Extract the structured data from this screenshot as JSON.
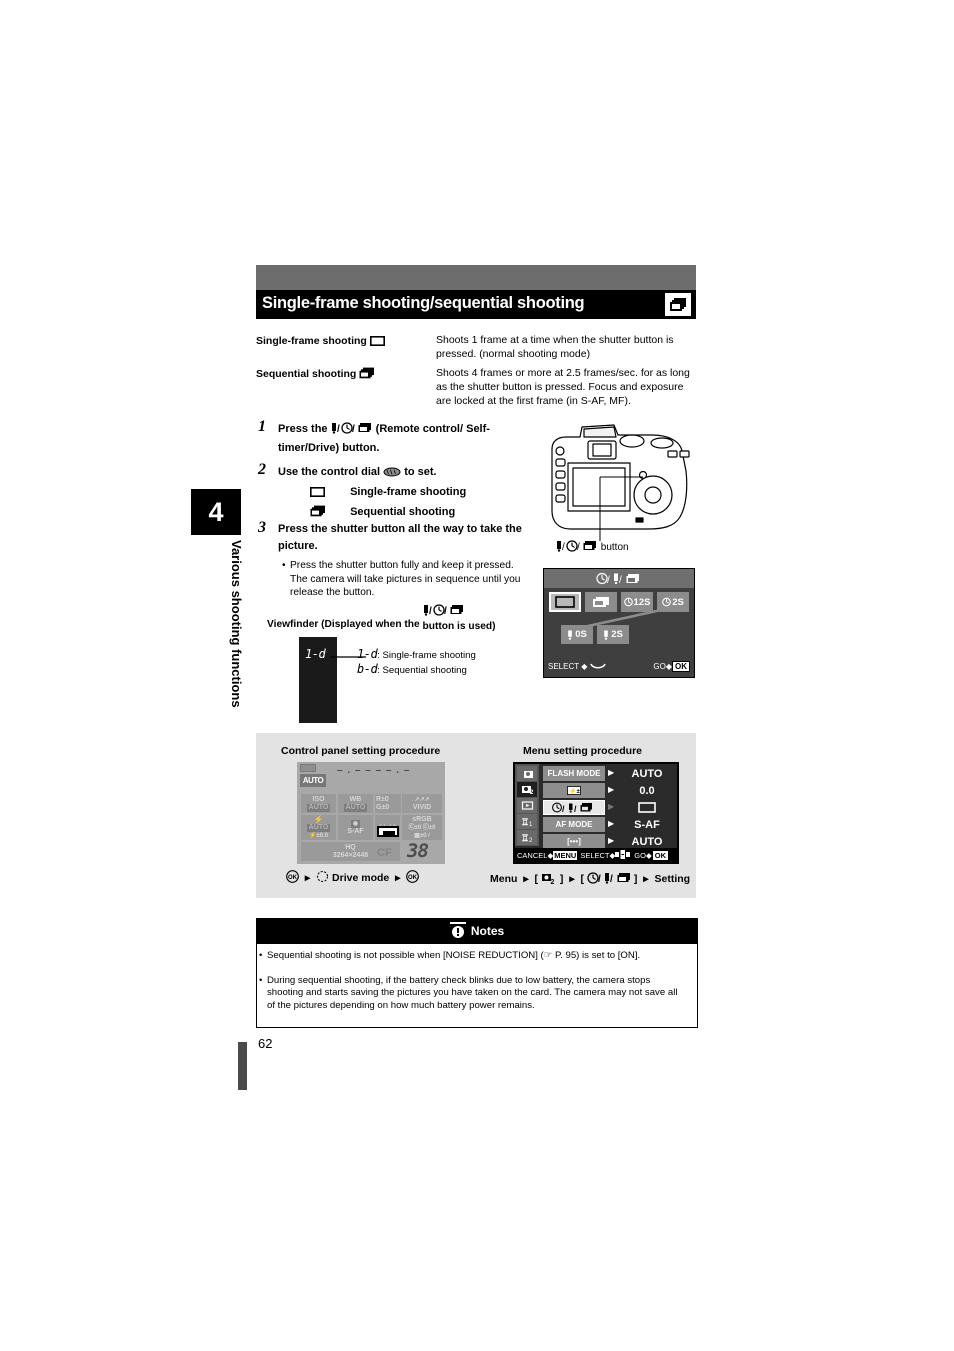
{
  "sidebar": {
    "chapter_number": "4",
    "chapter_title": "Various shooting functions"
  },
  "header": {
    "title": "Single-frame shooting/sequential shooting",
    "badge_icon": "sequential-shooting-icon"
  },
  "definitions": [
    {
      "term": "Single-frame shooting",
      "term_icon": "single-frame-icon",
      "body": "Shoots 1 frame at a time when the shutter button is pressed. (normal shooting mode)"
    },
    {
      "term": "Sequential shooting",
      "term_icon": "sequential-shooting-icon",
      "body": "Shoots 4 frames or more at 2.5 frames/sec. for as long as the shutter button is pressed. Focus and exposure are locked at the first frame (in S-AF, MF)."
    }
  ],
  "steps": [
    {
      "number": "1",
      "text_before": "Press the",
      "icon": "remote-selftimer-drive-icon",
      "text_after": "(Remote control/ Self-timer/Drive) button."
    },
    {
      "number": "2",
      "text_before": "Use the control dial",
      "icon": "control-dial-icon",
      "text_after": "to set.",
      "options": [
        {
          "icon": "single-frame-icon",
          "label": "Single-frame shooting"
        },
        {
          "icon": "sequential-shooting-icon",
          "label": "Sequential shooting"
        }
      ]
    },
    {
      "number": "3",
      "text_before": "Press the shutter button all the way to take the picture.",
      "bullet": "Press the shutter button fully and keep it pressed. The camera will take pictures in sequence until you release the button."
    }
  ],
  "viewfinder": {
    "caption": "Viewfinder (Displayed when the",
    "caption_icon": "remote-selftimer-drive-icon",
    "caption_end": "button is used)",
    "display_value": "1-d",
    "legend": [
      {
        "code": "1-d",
        "label": ": Single-frame shooting"
      },
      {
        "code": "b-d",
        "label": ": Sequential shooting"
      }
    ]
  },
  "camera_figure": {
    "caption_icon": "remote-selftimer-drive-icon",
    "caption": "button"
  },
  "drive_lcd": {
    "title": "◴/☉/❐",
    "title_text": "Self-timer / Remote / Drive",
    "row1": [
      {
        "label": "",
        "icon": "single-frame-icon",
        "selected": true
      },
      {
        "label": "",
        "icon": "sequential-shooting-icon",
        "selected": false
      },
      {
        "label": "12S",
        "icon": "self-timer-icon",
        "selected": false
      },
      {
        "label": "2S",
        "icon": "self-timer-icon",
        "selected": false
      }
    ],
    "row2": [
      {
        "label": "0S",
        "icon": "remote-icon",
        "selected": false
      },
      {
        "label": "2S",
        "icon": "remote-icon",
        "selected": false
      }
    ],
    "footer_left": "SELECT",
    "footer_right": "GO",
    "footer_ok": "OK"
  },
  "procedures": {
    "control_panel": {
      "heading": "Control panel setting procedure",
      "caption": "Drive mode",
      "panel": {
        "top_dashes": "– . – – –   – . –",
        "mode": "AUTO",
        "cells": [
          {
            "label": "ISO",
            "value": "AUTO"
          },
          {
            "label": "WB",
            "value": "AUTO"
          },
          {
            "label": "R±0",
            "value": "G±0"
          },
          {
            "label": "",
            "value": "VIVID"
          },
          {
            "label": "flash",
            "value": "AUTO"
          },
          {
            "label": "",
            "value": "S-AF"
          },
          {
            "label": "",
            "value": ""
          },
          {
            "label": "",
            "value": "sRGB"
          },
          {
            "label": "",
            "value": "±0.0"
          },
          {
            "label": "",
            "value": "±0"
          }
        ],
        "quality": "HQ",
        "resolution": "3264×2448",
        "card": "CF",
        "frames_remaining": "38"
      }
    },
    "menu": {
      "heading": "Menu setting procedure",
      "caption_parts": [
        "Menu",
        "[",
        "]",
        "[",
        "]",
        "Setting"
      ],
      "caption_tab": "2",
      "rows": [
        {
          "label": "FLASH MODE",
          "value": "AUTO",
          "highlight": false
        },
        {
          "label": "±",
          "value": "0.0",
          "highlight": false
        },
        {
          "label": "drive",
          "value": "single-frame-icon",
          "highlight": true
        },
        {
          "label": "AF MODE",
          "value": "S-AF",
          "highlight": false
        },
        {
          "label": "[•••]",
          "value": "AUTO",
          "highlight": false
        }
      ],
      "tabs": [
        "1",
        "2",
        "play",
        "1",
        "2"
      ],
      "footer": "CANCEL⮕MENU  SELECT⮕  GO⮕OK",
      "footer_cancel": "CANCEL",
      "footer_menu": "MENU",
      "footer_select": "SELECT",
      "footer_go": "GO",
      "footer_ok": "OK"
    }
  },
  "notes": {
    "heading": "Notes",
    "icon": "exclamation-icon",
    "items": [
      "Sequential shooting is not possible when [NOISE REDUCTION] (☞ P. 95) is set to [ON].",
      "During sequential shooting, if the battery check blinks due to low battery, the camera stops shooting and starts saving the pictures you have taken on the card. The camera may not save all of the pictures depending on how much battery power remains."
    ]
  },
  "page_number": "62"
}
